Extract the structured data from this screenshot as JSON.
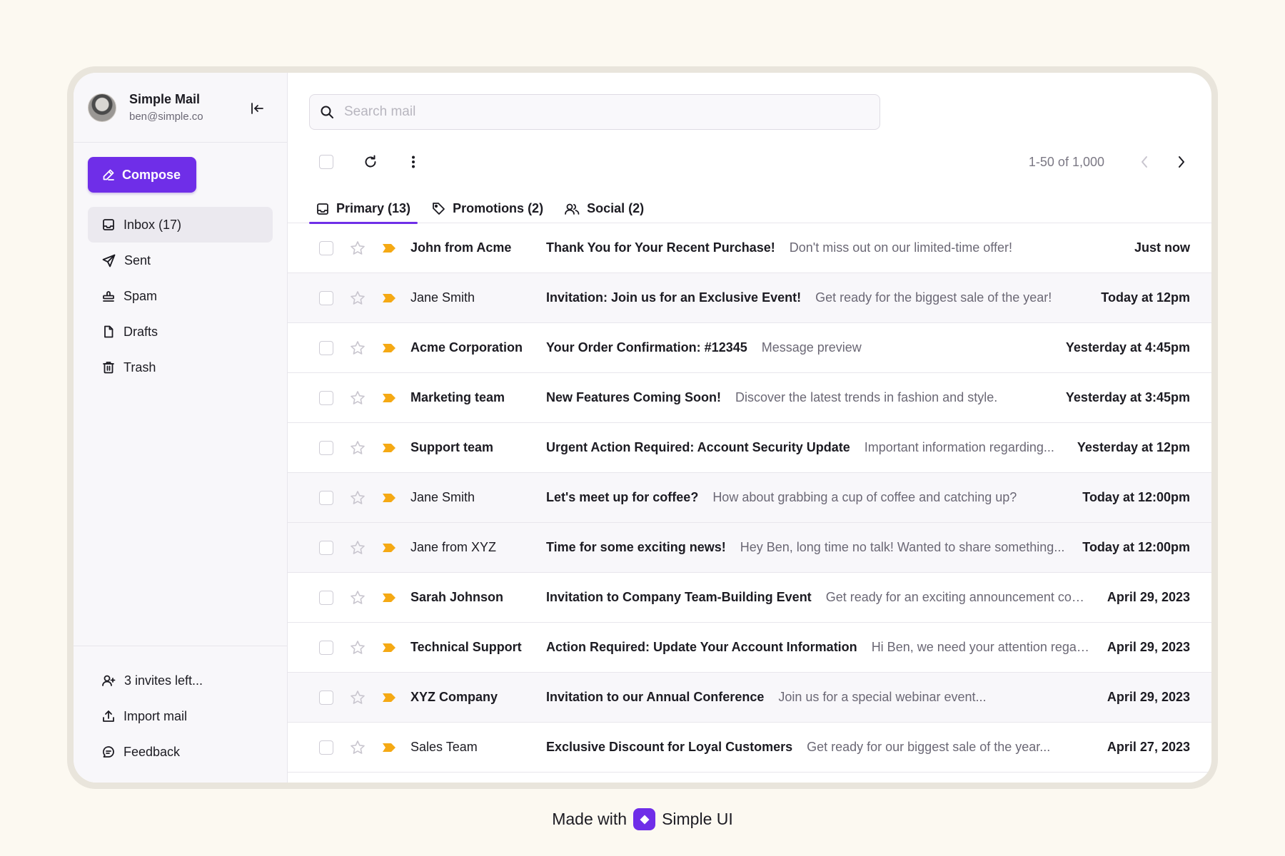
{
  "account": {
    "name": "Simple Mail",
    "email": "ben@simple.co"
  },
  "compose_label": "Compose",
  "nav": {
    "inbox": "Inbox (17)",
    "sent": "Sent",
    "spam": "Spam",
    "drafts": "Drafts",
    "trash": "Trash"
  },
  "sidebar_bottom": {
    "invites": "3 invites left...",
    "import": "Import mail",
    "feedback": "Feedback"
  },
  "search": {
    "placeholder": "Search mail"
  },
  "pager": {
    "range": "1-50 of 1,000"
  },
  "tabs": {
    "primary": "Primary (13)",
    "promotions": "Promotions (2)",
    "social": "Social (2)"
  },
  "accent_color": "#6f2ee8",
  "tag_color": "#f5a914",
  "emails": [
    {
      "sender": "John from Acme",
      "subject": "Thank You for Your Recent Purchase!",
      "preview": "Don't miss out on our limited-time offer!",
      "date": "Just now"
    },
    {
      "sender": "Jane Smith",
      "subject": "Invitation: Join us for an Exclusive Event!",
      "preview": "Get ready for the biggest sale of the year!",
      "date": "Today at 12pm"
    },
    {
      "sender": "Acme Corporation",
      "subject": "Your Order Confirmation: #12345",
      "preview": "Message preview",
      "date": "Yesterday at 4:45pm"
    },
    {
      "sender": "Marketing team",
      "subject": "New Features Coming Soon!",
      "preview": "Discover the latest trends in fashion and style.",
      "date": "Yesterday at 3:45pm"
    },
    {
      "sender": "Support team",
      "subject": "Urgent Action Required: Account Security Update",
      "preview": "Important information regarding...",
      "date": "Yesterday at 12pm"
    },
    {
      "sender": "Jane Smith",
      "subject": "Let's meet up for coffee?",
      "preview": "How about grabbing a cup of coffee and catching up?",
      "date": "Today at 12:00pm"
    },
    {
      "sender": "Jane from XYZ",
      "subject": "Time for some exciting news!",
      "preview": "Hey Ben, long time no talk! Wanted to share something...",
      "date": "Today at 12:00pm"
    },
    {
      "sender": "Sarah Johnson",
      "subject": "Invitation to Company Team-Building Event",
      "preview": "Get ready for an exciting announcement com...",
      "date": "April 29, 2023"
    },
    {
      "sender": "Technical Support",
      "subject": "Action Required: Update Your Account Information",
      "preview": "Hi Ben, we need your attention regar...",
      "date": "April 29, 2023"
    },
    {
      "sender": "XYZ Company",
      "subject": "Invitation to our Annual Conference",
      "preview": "Join us for a special webinar event...",
      "date": "April 29, 2023"
    },
    {
      "sender": "Sales Team",
      "subject": "Exclusive Discount for Loyal Customers",
      "preview": "Get ready for our biggest sale of the year...",
      "date": "April 27, 2023"
    }
  ],
  "footer": {
    "made_with": "Made with",
    "brand": "Simple UI"
  }
}
